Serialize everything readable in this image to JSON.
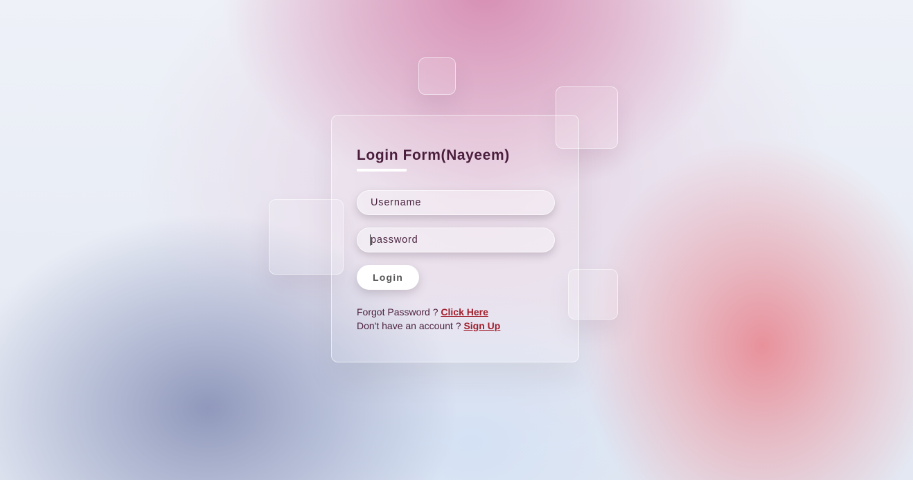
{
  "login_form": {
    "title": "Login Form(Nayeem)",
    "username_placeholder": "Username",
    "password_placeholder": "password",
    "login_button": "Login",
    "forgot_text": "Forgot Password ?",
    "forgot_link": "Click Here",
    "signup_text": "Don't have an account ?",
    "signup_link": "Sign Up"
  },
  "colors": {
    "title": "#4a1e3c",
    "link": "#a21f2c",
    "button_bg": "#ffffff",
    "button_text": "#555555"
  }
}
